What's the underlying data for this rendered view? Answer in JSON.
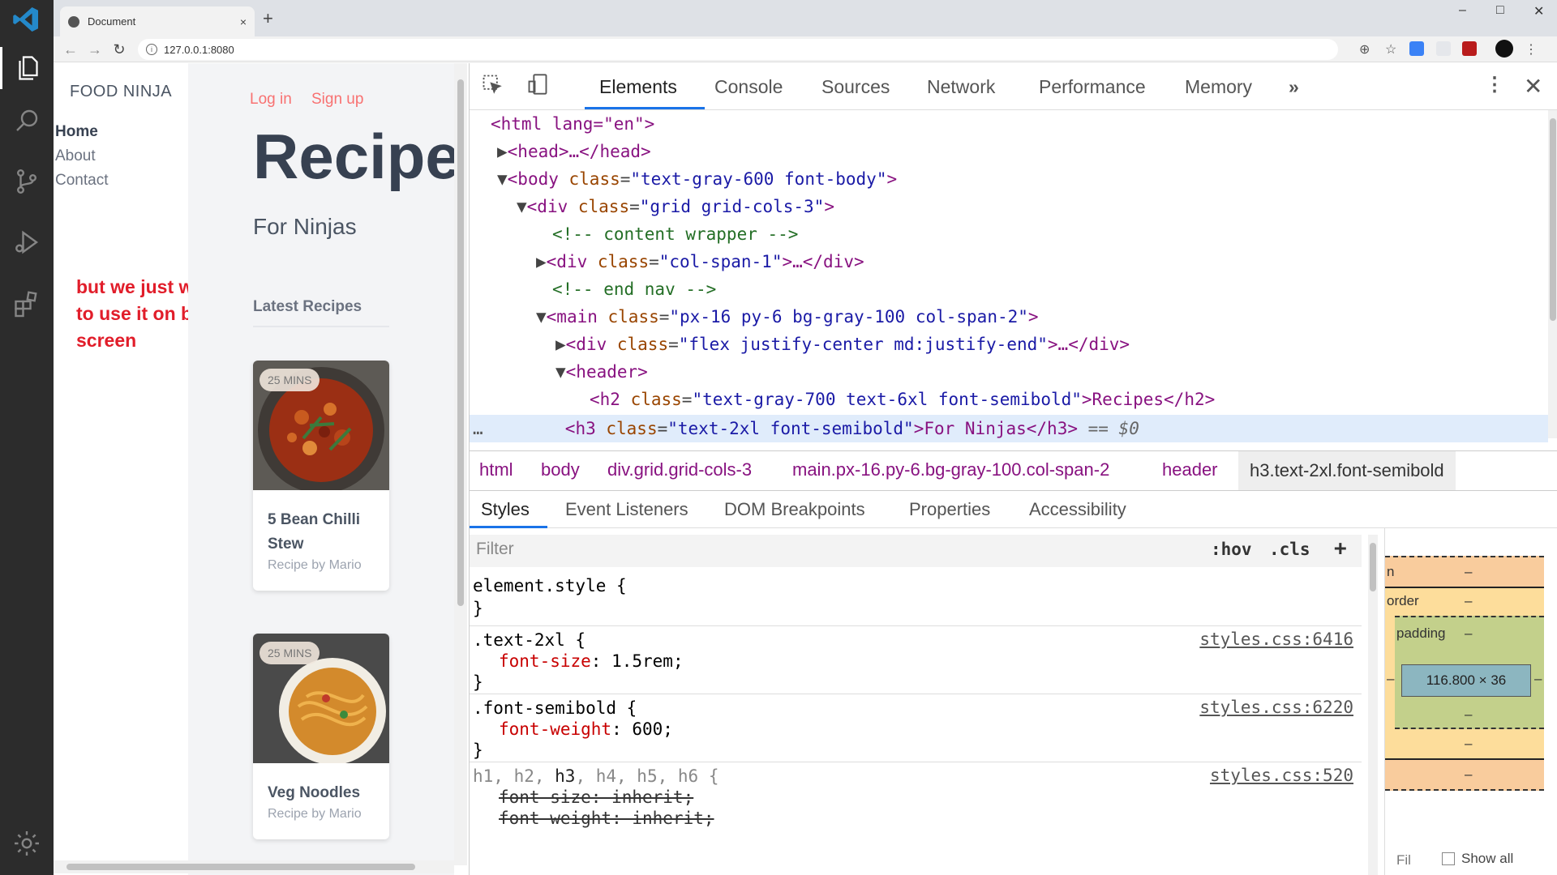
{
  "browser": {
    "tab_title": "Document",
    "tab_close": "×",
    "new_tab": "+",
    "url": "127.0.0.1:8080",
    "window_controls": [
      "–",
      "□",
      "✕"
    ]
  },
  "site": {
    "brand": "FOOD NINJA",
    "nav": [
      "Home",
      "About",
      "Contact"
    ],
    "login": "Log in",
    "signup": "Sign up",
    "heading": "Recipe",
    "subheading": "For Ninjas",
    "latest": "Latest Recipes",
    "cards": [
      {
        "badge": "25 MINS",
        "title_line1": "5 Bean Chilli",
        "title_line2": "Stew",
        "by": "Recipe by Mario"
      },
      {
        "badge": "25 MINS",
        "title_line1": "Veg Noodles",
        "title_line2": "",
        "by": "Recipe by Mario"
      }
    ]
  },
  "annotation": {
    "line1": "but we just want",
    "line2": "to use it on bigger",
    "line3": "screen",
    "color": "#e11d2a"
  },
  "devtools": {
    "tabs": [
      "Elements",
      "Console",
      "Sources",
      "Network",
      "Performance",
      "Memory"
    ],
    "more_tabs": "»",
    "dom": {
      "l1": "<html lang=\"en\">",
      "l2": "<head>…</head>",
      "l3_tag": "<body ",
      "l3_attr": "class",
      "l3_val": "\"text-gray-600 font-body\"",
      "l3_end": ">",
      "l4_tag": "<div ",
      "l4_attr": "class",
      "l4_val": "\"grid grid-cols-3\"",
      "l4_end": ">",
      "l5": "<!-- content wrapper -->",
      "l6_tag": "<div ",
      "l6_attr": "class",
      "l6_val": "\"col-span-1\"",
      "l6_end": ">…</div>",
      "l7": "<!-- end nav -->",
      "l8_tag": "<main ",
      "l8_attr": "class",
      "l8_val": "\"px-16 py-6 bg-gray-100 col-span-2\"",
      "l8_end": ">",
      "l9_tag": "<div ",
      "l9_attr": "class",
      "l9_val": "\"flex justify-center md:justify-end\"",
      "l9_end": ">…</div>",
      "l10": "<header>",
      "l11_tag": "<h2 ",
      "l11_attr": "class",
      "l11_val": "\"text-gray-700 text-6xl font-semibold\"",
      "l11_text": ">Recipes</h2>",
      "l12_tag": "<h3 ",
      "l12_attr": "class",
      "l12_val": "\"text-2xl font-semibold\"",
      "l12_text": ">For Ninjas</h3>",
      "l12_ref": " == $0"
    },
    "breadcrumbs": [
      "html",
      "body",
      "div.grid.grid-cols-3",
      "main.px-16.py-6.bg-gray-100.col-span-2",
      "header",
      "h3.text-2xl.font-semibold"
    ],
    "subtabs": [
      "Styles",
      "Event Listeners",
      "DOM Breakpoints",
      "Properties",
      "Accessibility"
    ],
    "filter_placeholder": "Filter",
    "hov": ":hov",
    "cls": ".cls",
    "add": "+",
    "rules": {
      "r1_sel": "element.style {",
      "r1_close": "}",
      "r2_sel": ".text-2xl {",
      "r2_prop": "font-size",
      "r2_val": " 1.5rem;",
      "r2_src": "styles.css:6416",
      "r2_close": "}",
      "r3_sel": ".font-semibold {",
      "r3_prop": "font-weight",
      "r3_val": " 600;",
      "r3_src": "styles.css:6220",
      "r3_close": "}",
      "r4_sel_a": "h1, h2, ",
      "r4_sel_b": "h3",
      "r4_sel_c": ", h4, h5, h6 {",
      "r4_src": "styles.css:520",
      "r4_p1": "font-size: inherit;",
      "r4_p2": "font-weight: inherit;"
    },
    "boxmodel": {
      "margin": "n",
      "border": "order",
      "padding": "padding",
      "dash": "–",
      "content": "116.800 × 36",
      "filter": "Fil",
      "show_all": "Show all"
    }
  }
}
